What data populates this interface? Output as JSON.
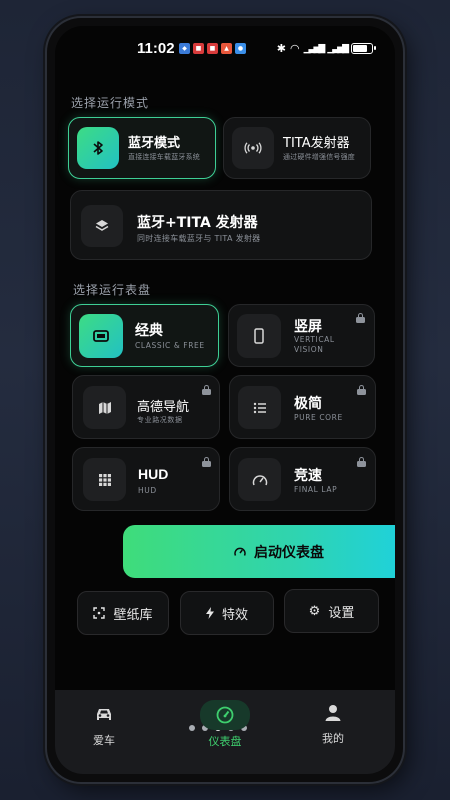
{
  "status_bar": {
    "time": "11:02"
  },
  "mode_section": {
    "label": "选择运行模式",
    "modes": [
      {
        "title": "蓝牙模式",
        "subtitle": "直接连接车载蓝牙系统",
        "icon": "bluetooth-icon",
        "active": true
      },
      {
        "title": "TITA发射器",
        "subtitle": "通过硬件增强信号强度",
        "icon": "broadcast-icon",
        "active": false
      },
      {
        "title": "蓝牙+TITA 发射器",
        "subtitle": "同时连接车载蓝牙与 TITA 发射器",
        "icon": "layers-icon",
        "active": false
      }
    ]
  },
  "dashboard_section": {
    "label": "选择运行表盘",
    "dashboards": [
      {
        "title": "经典",
        "subtitle": "CLASSIC & FREE",
        "icon": "rectangle-icon",
        "active": true,
        "locked": false
      },
      {
        "title": "竖屏",
        "subtitle": "VERTICAL VISION",
        "icon": "phone-icon",
        "active": false,
        "locked": true
      },
      {
        "title": "高德导航",
        "subtitle": "专业路况数据",
        "icon": "map-icon",
        "active": false,
        "locked": true
      },
      {
        "title": "极简",
        "subtitle": "PURE CORE",
        "icon": "list-icon",
        "active": false,
        "locked": true
      },
      {
        "title": "HUD",
        "subtitle": "HUD",
        "icon": "grid-icon",
        "active": false,
        "locked": true
      },
      {
        "title": "竞速",
        "subtitle": "FINAL LAP",
        "icon": "speedometer-icon",
        "active": false,
        "locked": true
      }
    ]
  },
  "actions": {
    "start_label": "启动仪表盘",
    "wallpaper_label": "壁纸库",
    "effects_label": "特效",
    "settings_label": "设置"
  },
  "tabbar": {
    "items": [
      {
        "label": "爱车",
        "icon": "car-icon",
        "active": false
      },
      {
        "label": "仪表盘",
        "icon": "gauge-icon",
        "active": true
      },
      {
        "label": "我的",
        "icon": "person-icon",
        "active": false
      }
    ],
    "page_dots": 5,
    "active_dot": 3
  },
  "colors": {
    "accent_start": "#3ddc84",
    "accent_end": "#1ad0e8",
    "active_tab": "#3ecf6e"
  }
}
